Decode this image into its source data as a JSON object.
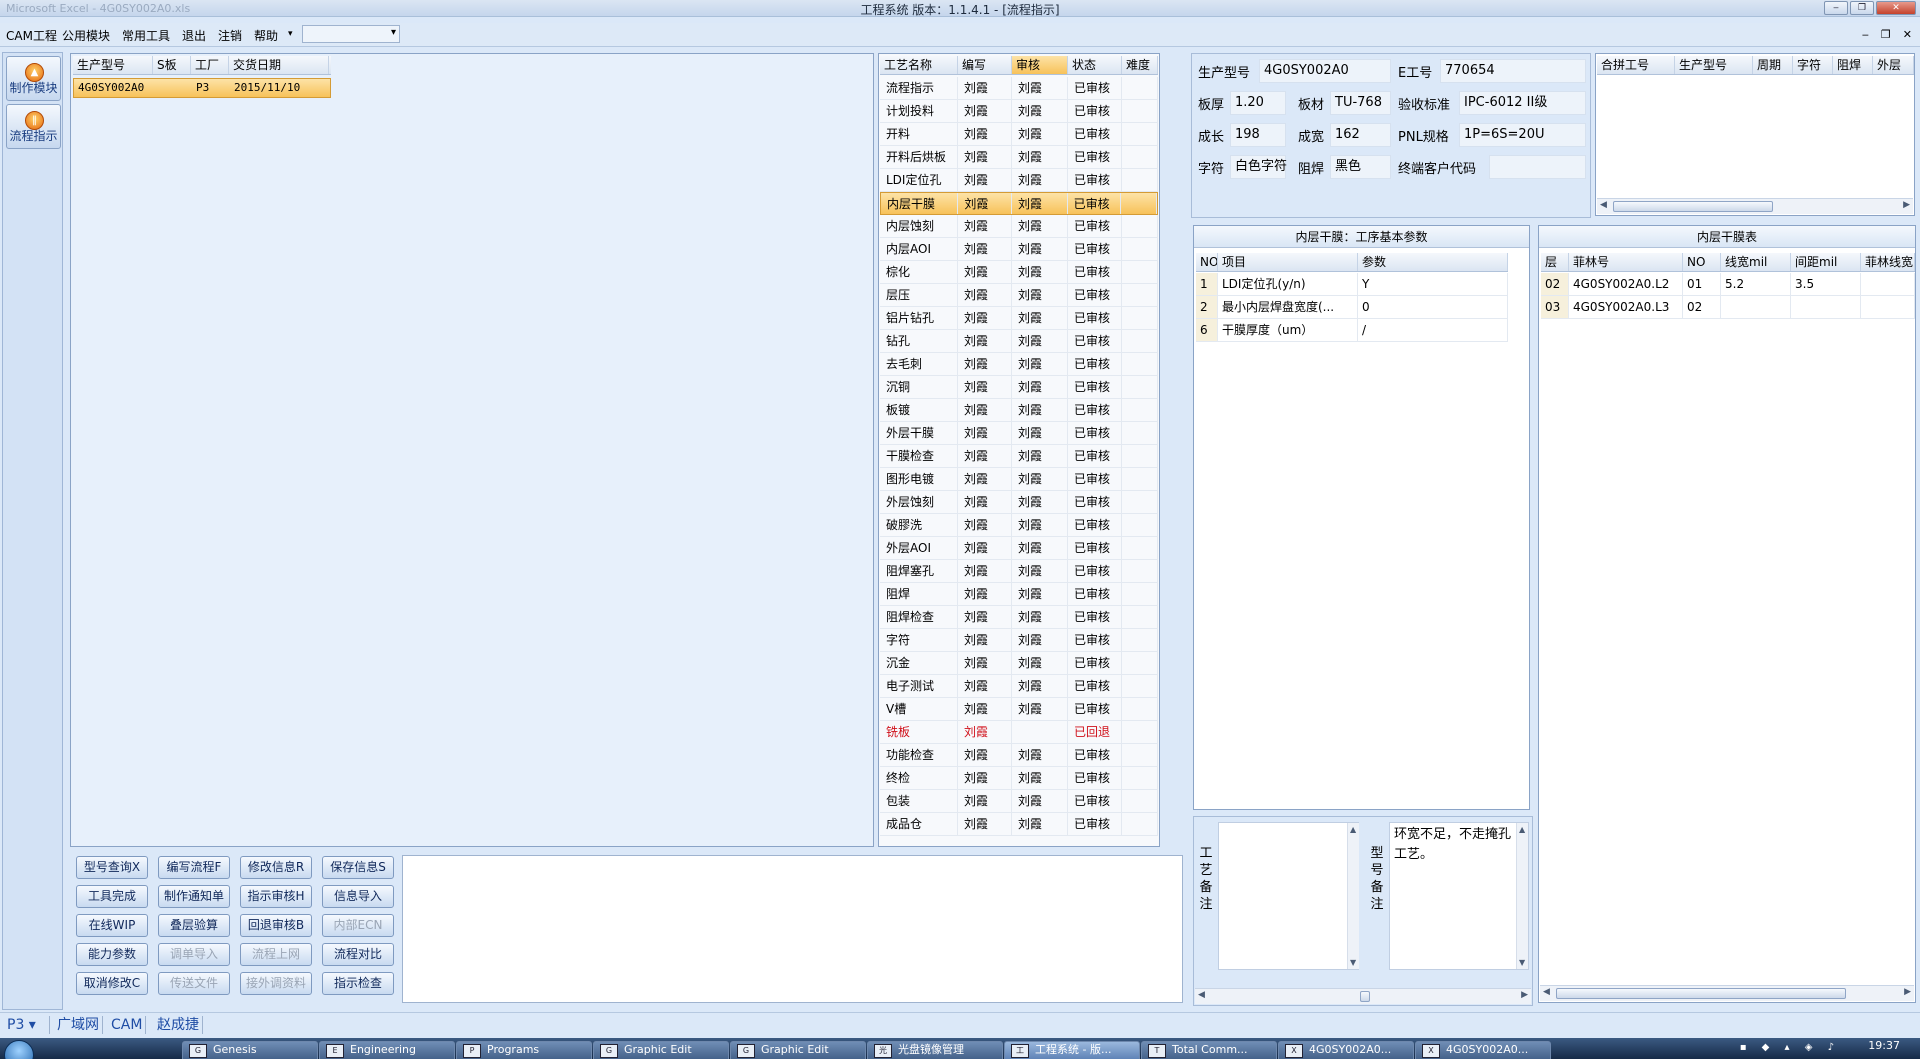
{
  "window": {
    "title": "工程系统   版本：1.1.4.1 - [流程指示]",
    "ghost_title": "Microsoft Excel - 4G0SY002A0.xls",
    "controls": [
      "‒",
      "❐",
      "✕"
    ]
  },
  "menubar": {
    "items": [
      "CAM工程",
      "公用模块",
      "常用工具",
      "退出",
      "注销",
      "帮助"
    ],
    "help_arrow": "▾",
    "combo_value": "",
    "mdi_controls": [
      "‒",
      "❐",
      "✕"
    ]
  },
  "leftnav": [
    {
      "label": "制作模块",
      "icon": "production-module-icon"
    },
    {
      "label": "流程指示",
      "icon": "process-instruction-icon"
    }
  ],
  "order_grid": {
    "columns": [
      "生产型号",
      "S板",
      "工厂",
      "交货日期"
    ],
    "rows": [
      {
        "model": "4G0SY002A0",
        "s_board": "",
        "factory": "P3",
        "date": "2015/11/10"
      }
    ]
  },
  "process_grid": {
    "columns": [
      "工艺名称",
      "编写",
      "审核",
      "状态",
      "难度"
    ],
    "selected_index": 5,
    "rows": [
      {
        "name": "流程指示",
        "writer": "刘霞",
        "reviewer": "刘霞",
        "status": "已审核",
        "difficulty": ""
      },
      {
        "name": "计划投料",
        "writer": "刘霞",
        "reviewer": "刘霞",
        "status": "已审核",
        "difficulty": ""
      },
      {
        "name": "开料",
        "writer": "刘霞",
        "reviewer": "刘霞",
        "status": "已审核",
        "difficulty": ""
      },
      {
        "name": "开料后烘板",
        "writer": "刘霞",
        "reviewer": "刘霞",
        "status": "已审核",
        "difficulty": ""
      },
      {
        "name": "LDI定位孔",
        "writer": "刘霞",
        "reviewer": "刘霞",
        "status": "已审核",
        "difficulty": ""
      },
      {
        "name": "内层干膜",
        "writer": "刘霞",
        "reviewer": "刘霞",
        "status": "已审核",
        "difficulty": ""
      },
      {
        "name": "内层蚀刻",
        "writer": "刘霞",
        "reviewer": "刘霞",
        "status": "已审核",
        "difficulty": ""
      },
      {
        "name": "内层AOI",
        "writer": "刘霞",
        "reviewer": "刘霞",
        "status": "已审核",
        "difficulty": ""
      },
      {
        "name": "棕化",
        "writer": "刘霞",
        "reviewer": "刘霞",
        "status": "已审核",
        "difficulty": ""
      },
      {
        "name": "层压",
        "writer": "刘霞",
        "reviewer": "刘霞",
        "status": "已审核",
        "difficulty": ""
      },
      {
        "name": "铝片钻孔",
        "writer": "刘霞",
        "reviewer": "刘霞",
        "status": "已审核",
        "difficulty": ""
      },
      {
        "name": "钻孔",
        "writer": "刘霞",
        "reviewer": "刘霞",
        "status": "已审核",
        "difficulty": ""
      },
      {
        "name": "去毛刺",
        "writer": "刘霞",
        "reviewer": "刘霞",
        "status": "已审核",
        "difficulty": ""
      },
      {
        "name": "沉铜",
        "writer": "刘霞",
        "reviewer": "刘霞",
        "status": "已审核",
        "difficulty": ""
      },
      {
        "name": "板镀",
        "writer": "刘霞",
        "reviewer": "刘霞",
        "status": "已审核",
        "difficulty": ""
      },
      {
        "name": "外层干膜",
        "writer": "刘霞",
        "reviewer": "刘霞",
        "status": "已审核",
        "difficulty": ""
      },
      {
        "name": "干膜检查",
        "writer": "刘霞",
        "reviewer": "刘霞",
        "status": "已审核",
        "difficulty": ""
      },
      {
        "name": "图形电镀",
        "writer": "刘霞",
        "reviewer": "刘霞",
        "status": "已审核",
        "difficulty": ""
      },
      {
        "name": "外层蚀刻",
        "writer": "刘霞",
        "reviewer": "刘霞",
        "status": "已审核",
        "difficulty": ""
      },
      {
        "name": "破膠洗",
        "writer": "刘霞",
        "reviewer": "刘霞",
        "status": "已审核",
        "difficulty": ""
      },
      {
        "name": "外层AOI",
        "writer": "刘霞",
        "reviewer": "刘霞",
        "status": "已审核",
        "difficulty": ""
      },
      {
        "name": "阻焊塞孔",
        "writer": "刘霞",
        "reviewer": "刘霞",
        "status": "已审核",
        "difficulty": ""
      },
      {
        "name": "阻焊",
        "writer": "刘霞",
        "reviewer": "刘霞",
        "status": "已审核",
        "difficulty": ""
      },
      {
        "name": "阻焊检查",
        "writer": "刘霞",
        "reviewer": "刘霞",
        "status": "已审核",
        "difficulty": ""
      },
      {
        "name": "字符",
        "writer": "刘霞",
        "reviewer": "刘霞",
        "status": "已审核",
        "difficulty": ""
      },
      {
        "name": "沉金",
        "writer": "刘霞",
        "reviewer": "刘霞",
        "status": "已审核",
        "difficulty": ""
      },
      {
        "name": "电子测试",
        "writer": "刘霞",
        "reviewer": "刘霞",
        "status": "已审核",
        "difficulty": ""
      },
      {
        "name": "V槽",
        "writer": "刘霞",
        "reviewer": "刘霞",
        "status": "已审核",
        "difficulty": ""
      },
      {
        "name": "铣板",
        "writer": "刘霞",
        "reviewer": "",
        "status": "已回退",
        "difficulty": "",
        "red": true
      },
      {
        "name": "功能检查",
        "writer": "刘霞",
        "reviewer": "刘霞",
        "status": "已审核",
        "difficulty": ""
      },
      {
        "name": "终检",
        "writer": "刘霞",
        "reviewer": "刘霞",
        "status": "已审核",
        "difficulty": ""
      },
      {
        "name": "包装",
        "writer": "刘霞",
        "reviewer": "刘霞",
        "status": "已审核",
        "difficulty": ""
      },
      {
        "name": "成品仓",
        "writer": "刘霞",
        "reviewer": "刘霞",
        "status": "已审核",
        "difficulty": ""
      }
    ]
  },
  "action_buttons": [
    {
      "label": "型号查询X",
      "name": "model-query-button",
      "enabled": true
    },
    {
      "label": "编写流程F",
      "name": "write-flow-button",
      "enabled": true
    },
    {
      "label": "修改信息R",
      "name": "modify-info-button",
      "enabled": true
    },
    {
      "label": "保存信息S",
      "name": "save-info-button",
      "enabled": true
    },
    {
      "label": "工具完成",
      "name": "tool-complete-button",
      "enabled": true
    },
    {
      "label": "制作通知单",
      "name": "make-notice-button",
      "enabled": true
    },
    {
      "label": "指示审核H",
      "name": "instruction-review-button",
      "enabled": true
    },
    {
      "label": "信息导入",
      "name": "info-import-button",
      "enabled": true
    },
    {
      "label": "在线WIP",
      "name": "online-wip-button",
      "enabled": true
    },
    {
      "label": "叠层验算",
      "name": "stackup-check-button",
      "enabled": true
    },
    {
      "label": "回退审核B",
      "name": "rollback-review-button",
      "enabled": true
    },
    {
      "label": "内部ECN",
      "name": "internal-ecn-button",
      "enabled": false
    },
    {
      "label": "能力参数",
      "name": "capability-params-button",
      "enabled": true
    },
    {
      "label": "调单导入",
      "name": "order-import-button",
      "enabled": false
    },
    {
      "label": "流程上网",
      "name": "flow-upload-button",
      "enabled": false
    },
    {
      "label": "流程对比",
      "name": "flow-compare-button",
      "enabled": true
    },
    {
      "label": "取消修改C",
      "name": "cancel-modify-button",
      "enabled": true
    },
    {
      "label": "传送文件",
      "name": "send-file-button",
      "enabled": false
    },
    {
      "label": "接外调资料",
      "name": "external-data-button",
      "enabled": false
    },
    {
      "label": "指示检查",
      "name": "instruction-check-button",
      "enabled": true
    }
  ],
  "info": {
    "model_label": "生产型号",
    "model": "4G0SY002A0",
    "e_no_label": "E工号",
    "e_no": "770654",
    "thickness_label": "板厚",
    "thickness": "1.20",
    "material_label": "板材",
    "material": "TU-768",
    "standard_label": "验收标准",
    "standard": "IPC-6012 II级",
    "length_label": "成长",
    "length": "198",
    "width_label": "成宽",
    "width": "162",
    "pnl_label": "PNL规格",
    "pnl": "1P=6S=20U",
    "silk_label": "字符",
    "silk": "白色字符",
    "mask_label": "阻焊",
    "mask": "黑色",
    "customer_label": "终端客户代码",
    "customer": ""
  },
  "merge_grid": {
    "columns": [
      "合拼工号",
      "生产型号",
      "周期",
      "字符",
      "阻焊",
      "外层"
    ]
  },
  "params": {
    "title": "内层干膜：工序基本参数",
    "columns": [
      "NO",
      "项目",
      "参数"
    ],
    "rows": [
      {
        "no": "1",
        "item": "LDI定位孔(y/n)",
        "value": "Y"
      },
      {
        "no": "2",
        "item": "最小内层焊盘宽度(...",
        "value": "0"
      },
      {
        "no": "6",
        "item": "干膜厚度（um）",
        "value": "/"
      }
    ]
  },
  "film_table": {
    "title": "内层干膜表",
    "columns": [
      "层",
      "菲林号",
      "NO",
      "线宽mil",
      "间距mil",
      "菲林线宽"
    ],
    "rows": [
      {
        "layer": "02",
        "film": "4G0SY002A0.L2",
        "no": "01",
        "line": "5.2",
        "space": "3.5",
        "film_line": ""
      },
      {
        "layer": "03",
        "film": "4G0SY002A0.L3",
        "no": "02",
        "line": "",
        "space": "",
        "film_line": ""
      }
    ]
  },
  "notes": {
    "process_label": "工艺备注",
    "process_text": "",
    "model_label": "型号备注",
    "model_text": "环宽不足，不走掩孔工艺。"
  },
  "statusbar": {
    "factory": "P3",
    "items": [
      "广域网",
      "CAM",
      "赵成捷"
    ]
  },
  "taskbar": {
    "items": [
      {
        "label": "Genesis",
        "icon": "G"
      },
      {
        "label": "Engineering",
        "icon": "E"
      },
      {
        "label": "Programs",
        "icon": "P"
      },
      {
        "label": "Graphic Edit",
        "icon": "G"
      },
      {
        "label": "Graphic Edit",
        "icon": "G"
      },
      {
        "label": "光盘镜像管理",
        "icon": "光"
      },
      {
        "label": "工程系统 - 版...",
        "icon": "工",
        "active": true
      },
      {
        "label": "Total Comm...",
        "icon": "T"
      },
      {
        "label": "4G0SY002A0...",
        "icon": "X"
      },
      {
        "label": "4G0SY002A0...",
        "icon": "X"
      }
    ],
    "clock": "19:37"
  }
}
